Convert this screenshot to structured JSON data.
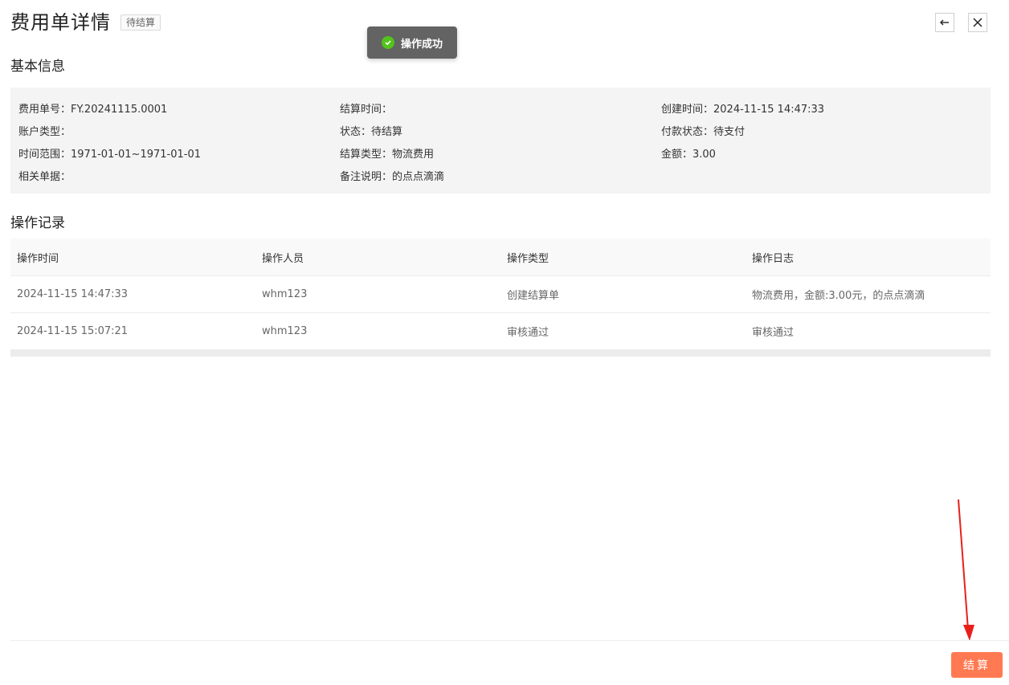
{
  "header": {
    "title": "费用单详情",
    "status_tag": "待结算"
  },
  "toast": {
    "message": "操作成功"
  },
  "basic_info": {
    "section_title": "基本信息",
    "fields": {
      "fee_no": "费用单号：FY.20241115.0001",
      "settle_time": "结算时间：",
      "create_time": "创建时间：2024-11-15 14:47:33",
      "account_type": "账户类型：",
      "status": "状态：待结算",
      "payment_status": "付款状态：待支付",
      "time_range": "时间范围：1971-01-01~1971-01-01",
      "settle_type": "结算类型：物流费用",
      "amount": "金额：3.00",
      "related_docs": "相关单据：",
      "remark": "备注说明：的点点滴滴"
    }
  },
  "operation_log": {
    "section_title": "操作记录",
    "columns": [
      "操作时间",
      "操作人员",
      "操作类型",
      "操作日志"
    ],
    "rows": [
      [
        "2024-11-15 14:47:33",
        "whm123",
        "创建结算单",
        "物流费用，金额:3.00元，的点点滴滴"
      ],
      [
        "2024-11-15 15:07:21",
        "whm123",
        "审核通过",
        "审核通过"
      ]
    ]
  },
  "footer": {
    "settle_button": "结算"
  },
  "colors": {
    "accent": "#ff7a52",
    "success": "#52c41a",
    "toast_bg": "#636363",
    "annotation_arrow": "#e8201a"
  },
  "icons": {
    "back": "arrow-left-icon",
    "close": "close-icon",
    "toast": "check-circle-icon"
  }
}
